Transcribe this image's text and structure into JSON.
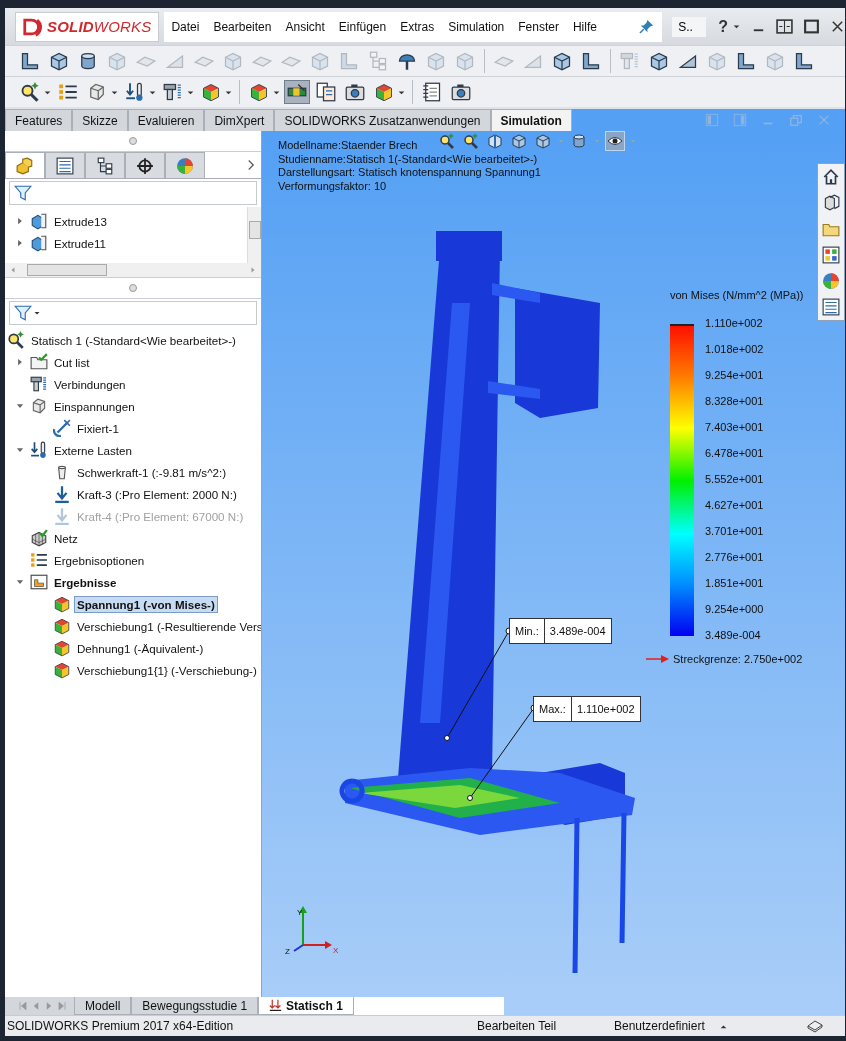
{
  "title_bar": {
    "logo": "**SOLID**WORKS",
    "menu": [
      "Datei",
      "Bearbeiten",
      "Ansicht",
      "Einfügen",
      "Extras",
      "Simulation",
      "Fenster",
      "Hilfe"
    ],
    "search": "S..",
    "help": "?"
  },
  "toolbar_1": {
    "groups": [
      [
        {
          "kind": "bracket",
          "disabled": false
        },
        {
          "kind": "cube",
          "disabled": false
        },
        {
          "kind": "cylinder",
          "disabled": false
        },
        {
          "kind": "cube",
          "disabled": true
        },
        {
          "kind": "plate",
          "disabled": true
        },
        {
          "kind": "wedge",
          "disabled": true
        },
        {
          "kind": "plate",
          "disabled": true
        },
        {
          "kind": "cube",
          "disabled": true
        },
        {
          "kind": "plate",
          "disabled": true
        },
        {
          "kind": "plate",
          "disabled": true
        },
        {
          "kind": "cube",
          "disabled": true
        },
        {
          "kind": "bracket",
          "disabled": true
        },
        {
          "kind": "tree",
          "disabled": true
        },
        {
          "kind": "dome",
          "disabled": false
        },
        {
          "kind": "cube",
          "disabled": true
        },
        {
          "kind": "cube",
          "disabled": true
        }
      ],
      [
        {
          "kind": "plate",
          "disabled": true
        },
        {
          "kind": "wedge",
          "disabled": true
        },
        {
          "kind": "cube",
          "disabled": false
        },
        {
          "kind": "bracket",
          "disabled": false
        }
      ],
      [
        {
          "kind": "bolt",
          "disabled": true
        },
        {
          "kind": "cube",
          "disabled": false
        },
        {
          "kind": "wedge",
          "disabled": false
        },
        {
          "kind": "cube",
          "disabled": true
        },
        {
          "kind": "bracket",
          "disabled": false
        },
        {
          "kind": "cube",
          "disabled": true
        },
        {
          "kind": "bracket",
          "disabled": false
        }
      ]
    ]
  },
  "toolbar_2": {
    "groups": [
      [
        {
          "kind": "magnifier",
          "selected": false,
          "dropdown": true
        },
        {
          "kind": "list",
          "selected": false,
          "dropdown": false
        },
        {
          "kind": "block",
          "selected": false,
          "dropdown": true
        },
        {
          "kind": "load",
          "selected": false,
          "dropdown": true
        },
        {
          "kind": "bolt",
          "selected": false,
          "dropdown": true
        },
        {
          "kind": "color_cube",
          "selected": false,
          "dropdown": true
        }
      ],
      [
        {
          "kind": "color_cube",
          "selected": false,
          "dropdown": true
        },
        {
          "kind": "probe",
          "selected": true,
          "dropdown": false
        },
        {
          "kind": "documents",
          "selected": false,
          "dropdown": false
        },
        {
          "kind": "camera",
          "selected": false,
          "dropdown": false
        },
        {
          "kind": "color_cube",
          "selected": false,
          "dropdown": true
        }
      ],
      [
        {
          "kind": "notebook",
          "selected": false,
          "dropdown": false
        },
        {
          "kind": "camera",
          "selected": false,
          "dropdown": false
        }
      ]
    ]
  },
  "command_tabs": [
    {
      "label": "Features",
      "selected": false
    },
    {
      "label": "Skizze",
      "selected": false
    },
    {
      "label": "Evaluieren",
      "selected": false
    },
    {
      "label": "DimXpert",
      "selected": false
    },
    {
      "label": "SOLIDWORKS Zusatzanwendungen",
      "selected": false
    },
    {
      "label": "Simulation",
      "selected": true
    }
  ],
  "panel_tabs": [
    {
      "kind": "blocks",
      "selected": true
    },
    {
      "kind": "property_list",
      "selected": false
    },
    {
      "kind": "tree",
      "selected": false
    },
    {
      "kind": "crosshair",
      "selected": false
    },
    {
      "kind": "color_wheel",
      "selected": false
    }
  ],
  "feature_tree": {
    "items": [
      {
        "label": "Extrude13",
        "expanded": false
      },
      {
        "label": "Extrude11",
        "expanded": false
      }
    ]
  },
  "study_tree": {
    "items": [
      {
        "label": "Statisch 1 (-Standard<Wie bearbeitet>-)",
        "kind": "magnifier",
        "selected": false,
        "disabled": false,
        "bold": false,
        "children": [
          {
            "label": "Cut list",
            "kind": "checked_folder",
            "expanded": false,
            "selected": false,
            "disabled": false,
            "bold": false
          },
          {
            "label": "Verbindungen",
            "kind": "bolt",
            "selected": false,
            "disabled": false,
            "bold": false
          },
          {
            "label": "Einspannungen",
            "kind": "block",
            "expanded": true,
            "selected": false,
            "disabled": false,
            "bold": false,
            "children": [
              {
                "label": "Fixiert-1",
                "kind": "anchor",
                "selected": false,
                "disabled": false,
                "bold": false
              }
            ]
          },
          {
            "label": "Externe Lasten",
            "kind": "load",
            "expanded": true,
            "selected": false,
            "disabled": false,
            "bold": false,
            "children": [
              {
                "label": "Schwerkraft-1 (:-9.81 m/s^2:)",
                "kind": "cup",
                "selected": false,
                "disabled": false,
                "bold": false
              },
              {
                "label": "Kraft-3 (:Pro Element: 2000 N:)",
                "kind": "down_arrow",
                "selected": false,
                "disabled": false,
                "bold": false
              },
              {
                "label": "Kraft-4 (:Pro Element: 67000 N:)",
                "kind": "down_arrow",
                "selected": false,
                "disabled": true,
                "bold": false
              }
            ]
          },
          {
            "label": "Netz",
            "kind": "mesh",
            "selected": false,
            "disabled": false,
            "bold": false
          },
          {
            "label": "Ergebnisoptionen",
            "kind": "list",
            "selected": false,
            "disabled": false,
            "bold": false
          },
          {
            "label": "Ergebnisse",
            "kind": "results_folder",
            "expanded": true,
            "selected": false,
            "disabled": false,
            "bold": true,
            "children": [
              {
                "label": "Spannung1 (-von Mises-)",
                "kind": "color_cube",
                "selected": true,
                "disabled": false,
                "bold": true
              },
              {
                "label": "Verschiebung1 (-Resultierende Vers",
                "kind": "color_cube",
                "selected": false,
                "disabled": false,
                "bold": false
              },
              {
                "label": "Dehnung1 (-Äquivalent-)",
                "kind": "color_cube",
                "selected": false,
                "disabled": false,
                "bold": false
              },
              {
                "label": "Verschiebung1{1} (-Verschiebung-)",
                "kind": "color_cube",
                "selected": false,
                "disabled": false,
                "bold": false
              }
            ]
          }
        ]
      }
    ]
  },
  "viewport": {
    "info_lines": [
      "Modellname:Staender Brech",
      "Studienname:Statisch 1(-Standard<Wie bearbeitet>-)",
      "Darstellungsart: Statisch knotenspannung Spannung1",
      "Verformungsfaktor: 10"
    ],
    "heads_up_toolbar": [
      {
        "kind": "magnifier",
        "selected": false,
        "dropdown": false
      },
      {
        "kind": "magnifier",
        "selected": false,
        "dropdown": false
      },
      {
        "kind": "section",
        "selected": false,
        "dropdown": false
      },
      {
        "kind": "cube",
        "selected": false,
        "dropdown": false
      },
      {
        "kind": "cube",
        "selected": false,
        "dropdown": true
      },
      {
        "kind": "cylinder",
        "selected": false,
        "dropdown": true
      },
      {
        "kind": "eye",
        "selected": true,
        "dropdown": true
      }
    ],
    "legend": {
      "title": "von Mises (N/mm^2 (MPa))",
      "labels": [
        "1.110e+002",
        "1.018e+002",
        "9.254e+001",
        "8.328e+001",
        "7.403e+001",
        "6.478e+001",
        "5.552e+001",
        "4.627e+001",
        "3.701e+001",
        "2.776e+001",
        "1.851e+001",
        "9.254e+000",
        "3.489e-004"
      ],
      "yield": "Streckgrenze: 2.750e+002"
    },
    "min_probe": {
      "label": "Min.:",
      "value": "3.489e-004"
    },
    "max_probe": {
      "label": "Max.:",
      "value": "1.110e+002"
    },
    "triad": {
      "x": "X",
      "y": "Y",
      "z": "Z"
    }
  },
  "bottom_tabs": [
    {
      "label": "Modell",
      "selected": false
    },
    {
      "label": "Bewegungsstudie 1",
      "selected": false
    },
    {
      "label": "Statisch 1",
      "selected": true
    }
  ],
  "status_bar": {
    "edition": "SOLIDWORKS Premium 2017 x64-Edition",
    "mode": "Bearbeiten Teil",
    "units": "Benutzerdefiniert"
  }
}
